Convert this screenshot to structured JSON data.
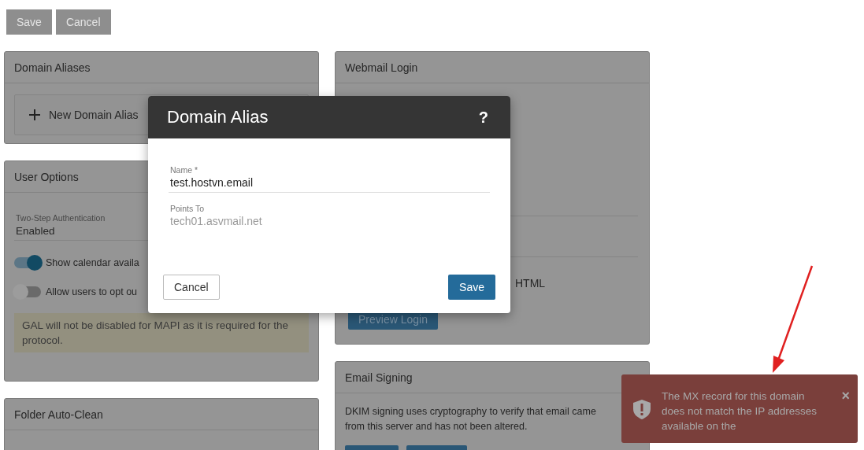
{
  "toolbar": {
    "buttons": [
      "Save",
      "Cancel"
    ]
  },
  "left_column": {
    "domain_aliases": {
      "title": "Domain Aliases",
      "new_button": "New Domain Alias"
    },
    "user_options": {
      "title": "User Options",
      "field": {
        "label": "Two-Step Authentication",
        "value": "Enabled"
      },
      "toggles": [
        {
          "label": "Show calendar availa",
          "on": true
        },
        {
          "label": "Allow users to opt ou",
          "on": false
        }
      ],
      "note": "GAL will not be disabled for MAPI as it is required for the protocol."
    },
    "folder_auto_clean": {
      "title": "Folder Auto-Clean"
    }
  },
  "middle_column": {
    "webmail_login": {
      "title": "Webmail Login",
      "option_text": "HTML",
      "preview_button": "Preview Login"
    },
    "email_signing": {
      "title": "Email Signing",
      "description": "DKIM signing uses cryptography to verify that email came from this server and has not been altered."
    }
  },
  "dialog": {
    "title": "Domain Alias",
    "help": "?",
    "fields": [
      {
        "label": "Name *",
        "value": "test.hostvn.email",
        "kind": "input"
      },
      {
        "label": "Points To",
        "value": "tech01.asvmail.net",
        "kind": "readonly"
      }
    ],
    "buttons": [
      {
        "label": "Cancel",
        "kind": "secondary"
      },
      {
        "label": "Save",
        "kind": "primary"
      }
    ]
  },
  "toast": {
    "message": "The MX record for this domain does not match the IP addresses available on the",
    "close": "×"
  }
}
